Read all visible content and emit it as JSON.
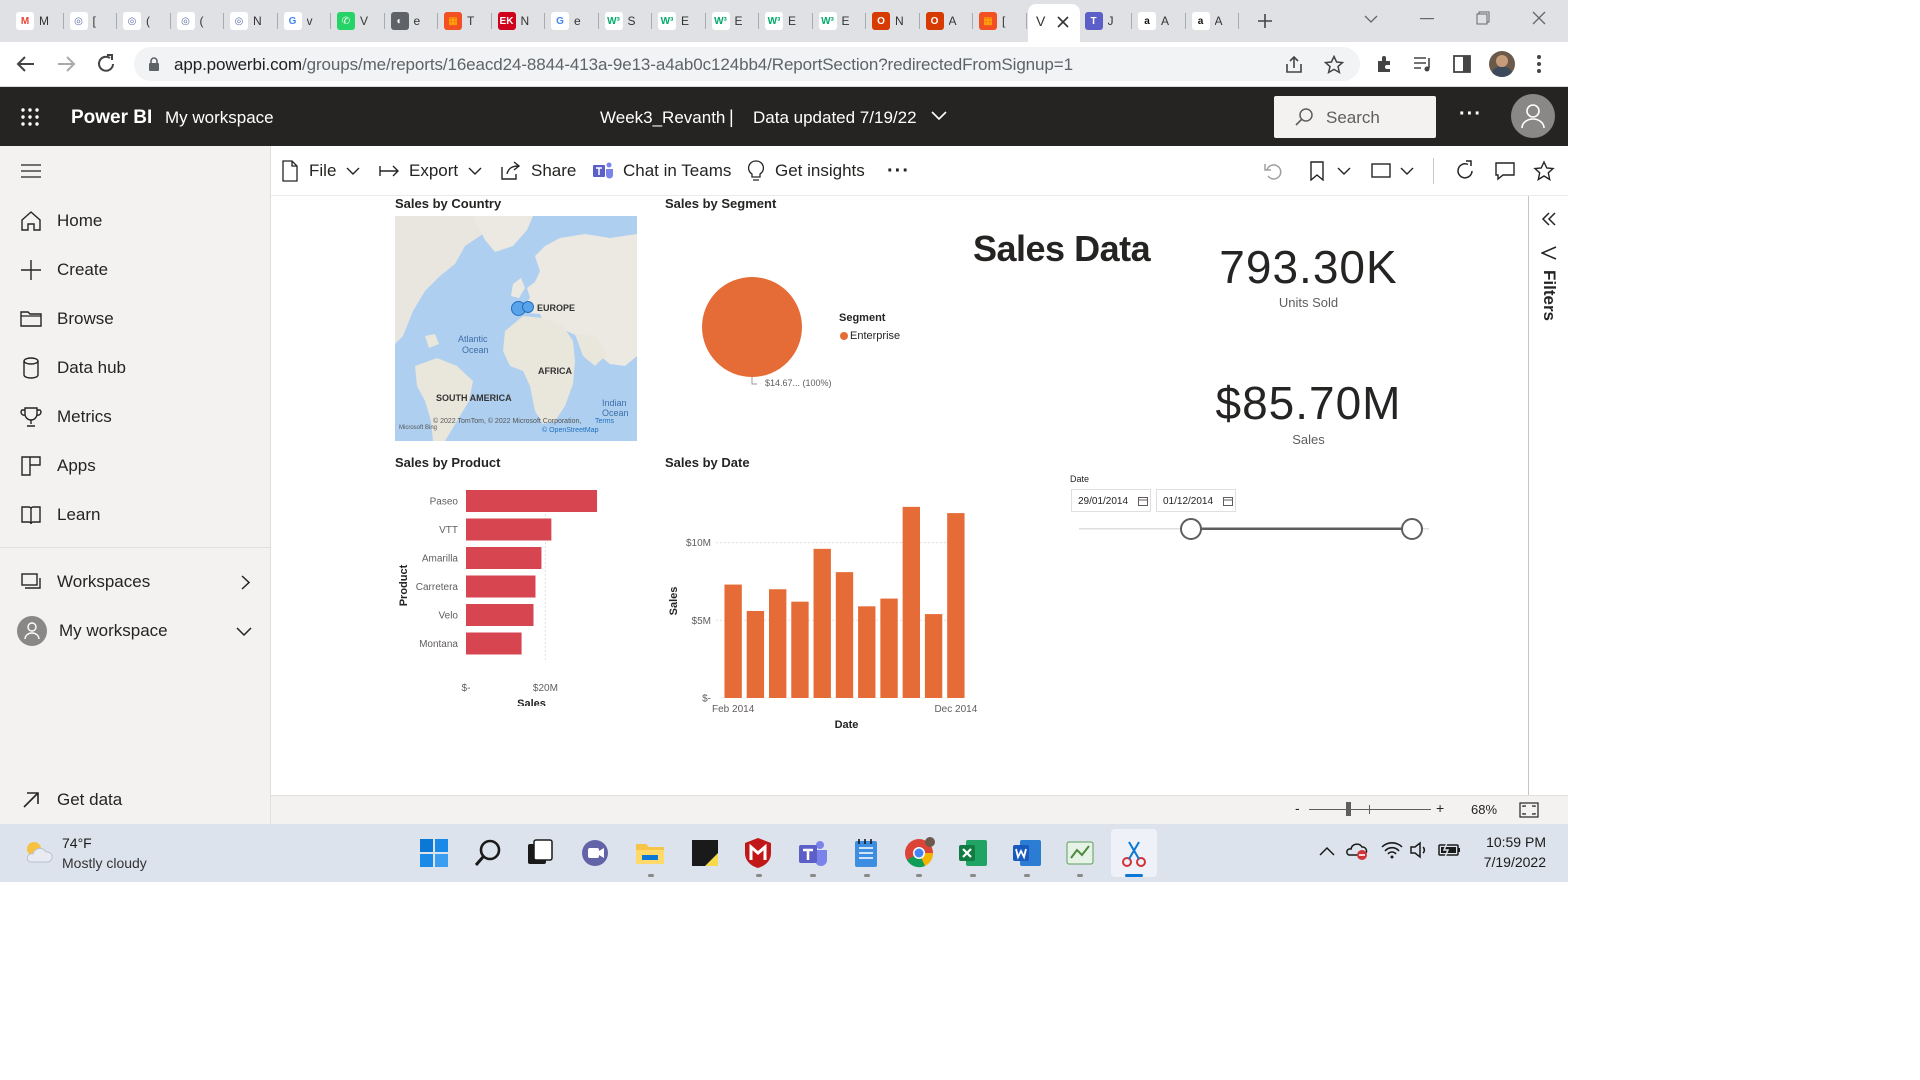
{
  "browser": {
    "tabs": [
      {
        "icon": "gmail-icon",
        "label": "M",
        "color": "#ffffff",
        "glyph": "M",
        "fg": "#ea4335"
      },
      {
        "icon": "seal-icon",
        "label": "[",
        "color": "#ffffff",
        "glyph": "◎",
        "fg": "#5a6fa8"
      },
      {
        "icon": "seal-icon",
        "label": "(",
        "color": "#ffffff",
        "glyph": "◎",
        "fg": "#5a6fa8"
      },
      {
        "icon": "seal-icon",
        "label": "(",
        "color": "#ffffff",
        "glyph": "◎",
        "fg": "#5a6fa8"
      },
      {
        "icon": "seal-icon",
        "label": "N",
        "color": "#ffffff",
        "glyph": "◎",
        "fg": "#5a6fa8"
      },
      {
        "icon": "google-icon",
        "label": "v",
        "color": "#ffffff",
        "glyph": "G",
        "fg": "#4285f4"
      },
      {
        "icon": "whatsapp-icon",
        "label": "V",
        "color": "#25d366",
        "glyph": "✆",
        "fg": "#ffffff"
      },
      {
        "icon": "globe-icon",
        "label": "e",
        "color": "#5f6368",
        "glyph": "◐",
        "fg": "#ffffff"
      },
      {
        "icon": "microsoft-icon",
        "label": "T",
        "color": "#f25022",
        "glyph": "▦",
        "fg": "#ffb900"
      },
      {
        "icon": "ek-icon",
        "label": "N",
        "color": "#d0021b",
        "glyph": "EK",
        "fg": "#ffffff"
      },
      {
        "icon": "google-icon",
        "label": "e",
        "color": "#ffffff",
        "glyph": "G",
        "fg": "#4285f4"
      },
      {
        "icon": "w3schools-icon",
        "label": "S",
        "color": "#ffffff",
        "glyph": "W³",
        "fg": "#04aa6d"
      },
      {
        "icon": "w3schools-icon",
        "label": "E",
        "color": "#ffffff",
        "glyph": "W³",
        "fg": "#04aa6d"
      },
      {
        "icon": "w3schools-icon",
        "label": "E",
        "color": "#ffffff",
        "glyph": "W³",
        "fg": "#04aa6d"
      },
      {
        "icon": "w3schools-icon",
        "label": "E",
        "color": "#ffffff",
        "glyph": "W³",
        "fg": "#04aa6d"
      },
      {
        "icon": "w3schools-icon",
        "label": "E",
        "color": "#ffffff",
        "glyph": "W³",
        "fg": "#04aa6d"
      },
      {
        "icon": "office-icon",
        "label": "N",
        "color": "#d83b01",
        "glyph": "O",
        "fg": "#ffffff"
      },
      {
        "icon": "office-icon",
        "label": "A",
        "color": "#d83b01",
        "glyph": "O",
        "fg": "#ffffff"
      },
      {
        "icon": "microsoft-icon",
        "label": "[",
        "color": "#f25022",
        "glyph": "▦",
        "fg": "#ffb900"
      },
      {
        "icon": "teams-icon",
        "label": "J",
        "color": "#5b5fc7",
        "glyph": "T",
        "fg": "#ffffff"
      },
      {
        "icon": "amazon-icon",
        "label": "A",
        "color": "#ffffff",
        "glyph": "a",
        "fg": "#111111"
      },
      {
        "icon": "amazon-icon",
        "label": "A",
        "color": "#ffffff",
        "glyph": "a",
        "fg": "#111111"
      }
    ],
    "active_tab_label": "V",
    "url_host": "app.powerbi.com",
    "url_path": "/groups/me/reports/16eacd24-8844-413a-9e13-a4ab0c124bb4/ReportSection?redirectedFromSignup=1"
  },
  "header": {
    "app_name": "Power BI",
    "workspace": "My workspace",
    "report_name": "Week3_Revanth",
    "separator": "|",
    "data_updated": "Data updated 7/19/22",
    "search_placeholder": "Search",
    "more": "···"
  },
  "nav": {
    "items": [
      {
        "label": "Home",
        "icon": "home-icon"
      },
      {
        "label": "Create",
        "icon": "plus-icon"
      },
      {
        "label": "Browse",
        "icon": "folder-icon"
      },
      {
        "label": "Data hub",
        "icon": "database-icon"
      },
      {
        "label": "Metrics",
        "icon": "trophy-icon"
      },
      {
        "label": "Apps",
        "icon": "apps-icon"
      },
      {
        "label": "Learn",
        "icon": "book-icon"
      }
    ],
    "workspaces": "Workspaces",
    "my_workspace": "My workspace",
    "get_data": "Get data"
  },
  "toolbar": {
    "file": "File",
    "export": "Export",
    "share": "Share",
    "chat_in_teams": "Chat in Teams",
    "get_insights": "Get insights",
    "more": "···"
  },
  "report": {
    "title": "Sales Data",
    "map": {
      "title": "Sales by Country",
      "labels": {
        "europe": "EUROPE",
        "atlantic": "Atlantic",
        "ocean": "Ocean",
        "africa": "AFRICA",
        "south_america": "SOUTH AMERICA",
        "indian": "Indian",
        "indian_ocean": "Ocean"
      },
      "attribution": "© 2022 TomTom, © 2022 Microsoft Corporation,",
      "terms": "Terms",
      "osm": "© OpenStreetMap",
      "bing": "Microsoft Bing"
    },
    "pie": {
      "title": "Sales by Segment",
      "legend_title": "Segment",
      "legend_item": "Enterprise",
      "data_label": "$14.67... (100%)",
      "color": "#e66c37"
    },
    "kpi_units": {
      "value": "793.30K",
      "label": "Units Sold"
    },
    "kpi_sales": {
      "value": "$85.70M",
      "label": "Sales"
    },
    "slicer": {
      "title": "Date",
      "start": "29/01/2014",
      "end": "01/12/2014",
      "start_frac": 0,
      "end_frac": 1
    },
    "product_chart": {
      "title": "Sales by Product",
      "color": "#d64550"
    },
    "date_chart": {
      "title": "Sales by Date",
      "color": "#e66c37"
    }
  },
  "chart_data": [
    {
      "type": "bar",
      "title": "Sales by Product",
      "orientation": "horizontal",
      "categories": [
        "Paseo",
        "VTT",
        "Amarilla",
        "Carretera",
        "Velo",
        "Montana"
      ],
      "values": [
        33,
        21.5,
        19,
        17.5,
        17,
        14
      ],
      "unit": "$M",
      "xlabel": "Sales",
      "ylabel": "Product",
      "xticks": [
        "$-",
        "$20M"
      ],
      "xlim": [
        0,
        34
      ]
    },
    {
      "type": "bar",
      "title": "Sales by Date",
      "categories": [
        "Feb 2014",
        "Mar 2014",
        "Apr 2014",
        "May 2014",
        "Jun 2014",
        "Jul 2014",
        "Aug 2014",
        "Sep 2014",
        "Oct 2014",
        "Nov 2014",
        "Dec 2014"
      ],
      "values": [
        7.3,
        5.6,
        7.0,
        6.2,
        9.6,
        8.1,
        5.9,
        6.4,
        12.3,
        5.4,
        11.9
      ],
      "unit": "$M",
      "xlabel": "Date",
      "ylabel": "Sales",
      "xticks": [
        "Feb 2014",
        "Dec 2014"
      ],
      "yticks": [
        "$-",
        "$5M",
        "$10M"
      ],
      "ylim": [
        0,
        13
      ]
    },
    {
      "type": "pie",
      "title": "Sales by Segment",
      "categories": [
        "Enterprise"
      ],
      "values": [
        100
      ],
      "unit": "%"
    }
  ],
  "filters": {
    "label": "Filters"
  },
  "status": {
    "zoom": "68%",
    "minus": "-",
    "plus": "+"
  },
  "taskbar": {
    "weather_temp": "74°F",
    "weather_desc": "Mostly cloudy",
    "time": "10:59 PM",
    "date": "7/19/2022"
  }
}
